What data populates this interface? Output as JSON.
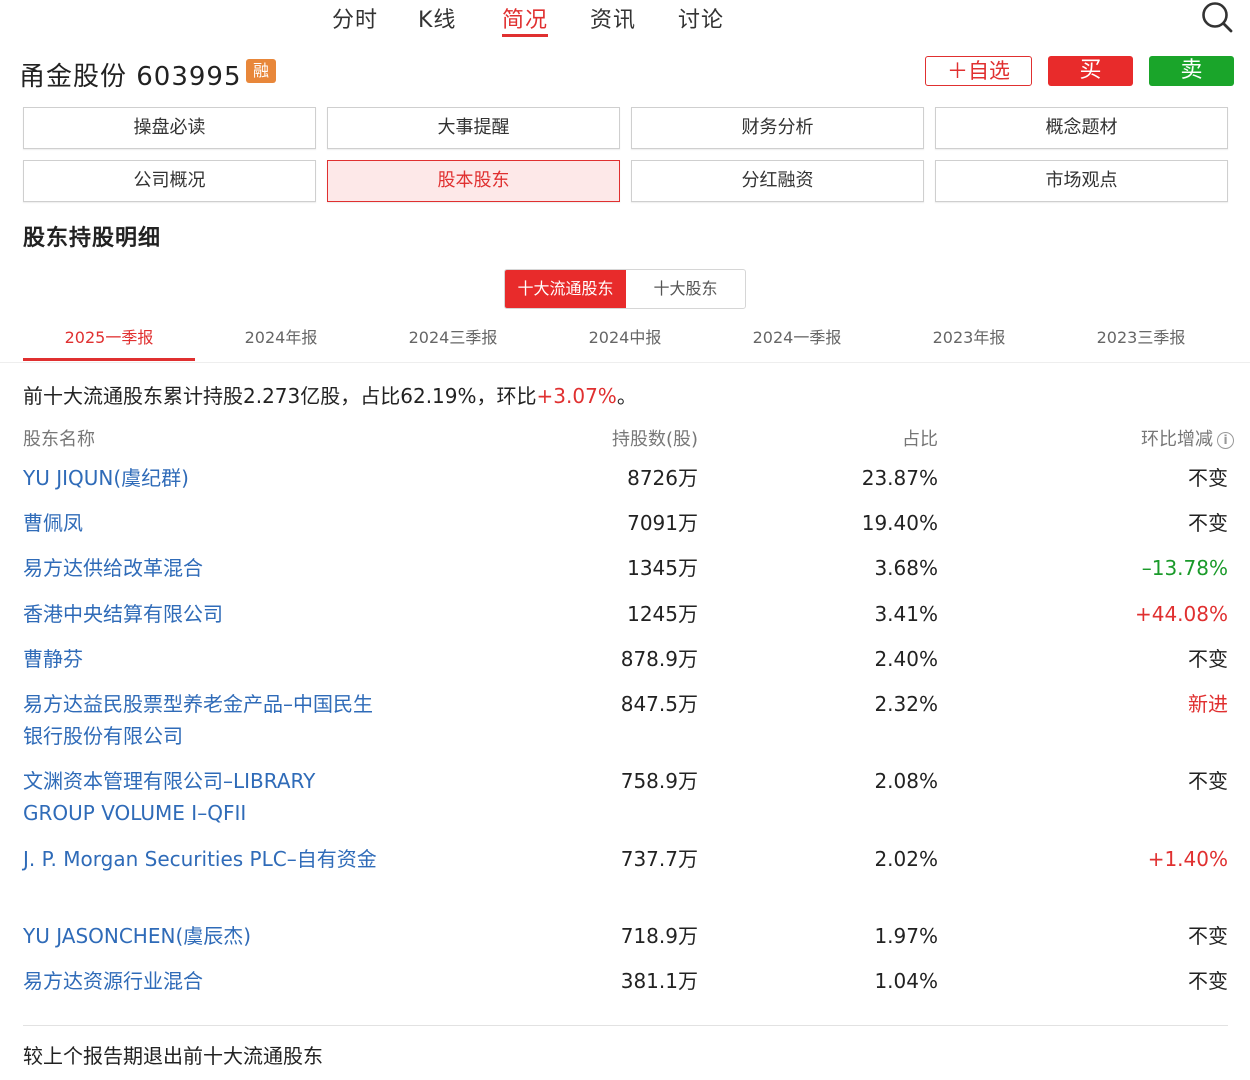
{
  "nav": {
    "tabs": [
      {
        "label": "分时"
      },
      {
        "label": "K线"
      },
      {
        "label": "简况"
      },
      {
        "label": "资讯"
      },
      {
        "label": "讨论"
      }
    ],
    "active_tab": "简况"
  },
  "stock": {
    "title": "甬金股份 603995",
    "badge": "融"
  },
  "actions": {
    "watch": "＋自选",
    "buy": "买",
    "sell": "卖"
  },
  "menu": {
    "items": [
      {
        "label": "操盘必读"
      },
      {
        "label": "大事提醒"
      },
      {
        "label": "财务分析"
      },
      {
        "label": "概念题材"
      },
      {
        "label": "公司概况"
      },
      {
        "label": "股本股东"
      },
      {
        "label": "分红融资"
      },
      {
        "label": "市场观点"
      }
    ],
    "active": "股本股东"
  },
  "section_title": "股东持股明细",
  "toggle": {
    "options": [
      {
        "label": "十大流通股东"
      },
      {
        "label": "十大股东"
      }
    ],
    "active": "十大流通股东"
  },
  "periods": {
    "items": [
      {
        "label": "2025一季报"
      },
      {
        "label": "2024年报"
      },
      {
        "label": "2024三季报"
      },
      {
        "label": "2024中报"
      },
      {
        "label": "2024一季报"
      },
      {
        "label": "2023年报"
      },
      {
        "label": "2023三季报"
      }
    ],
    "active": "2025一季报"
  },
  "summary": {
    "prefix": "前十大流通股东累计持股2.273亿股，占比62.19%，环比",
    "change": "+3.07%",
    "suffix": "。"
  },
  "table": {
    "headers": {
      "name": "股东名称",
      "shares": "持股数(股)",
      "ratio": "占比",
      "change": "环比增减"
    },
    "rows": [
      {
        "name": "YU JIQUN(虞纪群)",
        "shares": "8726万",
        "ratio": "23.87%",
        "change": "不变",
        "tone": "neutral"
      },
      {
        "name": "曹佩凤",
        "shares": "7091万",
        "ratio": "19.40%",
        "change": "不变",
        "tone": "neutral"
      },
      {
        "name": "易方达供给改革混合",
        "shares": "1345万",
        "ratio": "3.68%",
        "change": "–13.78%",
        "tone": "down"
      },
      {
        "name": "香港中央结算有限公司",
        "shares": "1245万",
        "ratio": "3.41%",
        "change": "+44.08%",
        "tone": "up"
      },
      {
        "name": "曹静芬",
        "shares": "878.9万",
        "ratio": "2.40%",
        "change": "不变",
        "tone": "neutral"
      },
      {
        "name": "易方达益民股票型养老金产品–中国民生银行股份有限公司",
        "shares": "847.5万",
        "ratio": "2.32%",
        "change": "新进",
        "tone": "up"
      },
      {
        "name": "文渊资本管理有限公司–LIBRARY GROUP VOLUME I–QFII",
        "shares": "758.9万",
        "ratio": "2.08%",
        "change": "不变",
        "tone": "neutral"
      },
      {
        "name": "J. P. Morgan Securities PLC–自有资金",
        "shares": "737.7万",
        "ratio": "2.02%",
        "change": "+1.40%",
        "tone": "up"
      },
      {
        "name": "YU JASONCHEN(虞辰杰)",
        "shares": "718.9万",
        "ratio": "1.97%",
        "change": "不变",
        "tone": "neutral"
      },
      {
        "name": "易方达资源行业混合",
        "shares": "381.1万",
        "ratio": "1.04%",
        "change": "不变",
        "tone": "neutral"
      }
    ]
  },
  "footer": "较上个报告期退出前十大流通股东",
  "colors": {
    "accent_red": "#e03030",
    "buy_red": "#e82b2b",
    "sell_green": "#1aa52a",
    "badge_orange": "#e8873a",
    "link_blue": "#2f6bb8",
    "down_green": "#1a9a2a"
  },
  "icons": {
    "search": "search-icon",
    "info": "info-icon"
  }
}
